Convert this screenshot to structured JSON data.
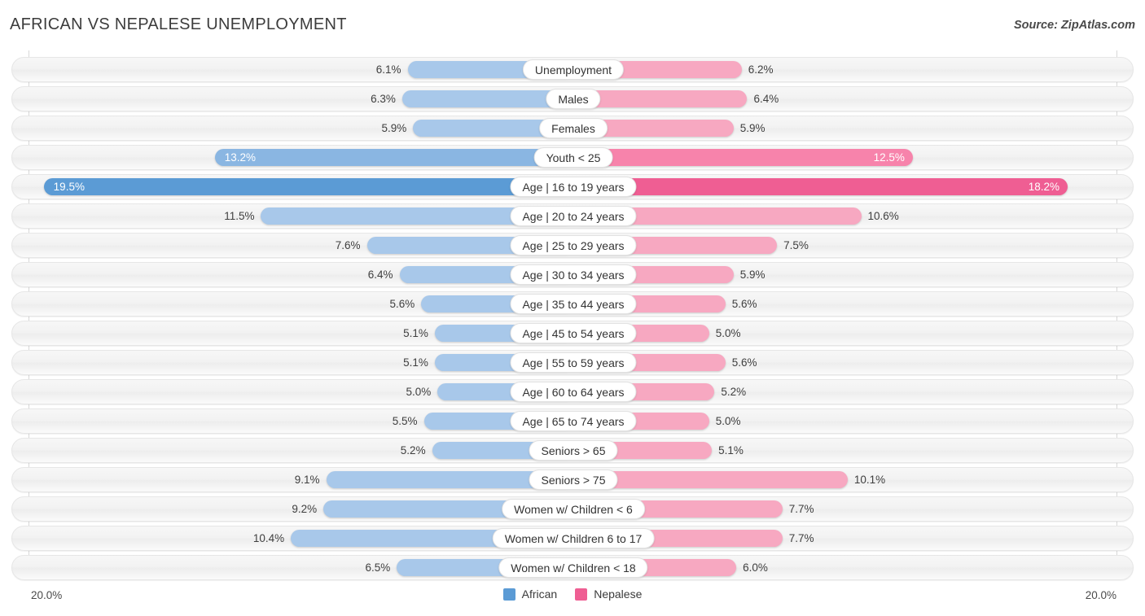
{
  "header": {
    "title": "AFRICAN VS NEPALESE UNEMPLOYMENT",
    "source": "Source: ZipAtlas.com"
  },
  "axis": {
    "left_label": "20.0%",
    "right_label": "20.0%",
    "max": 20.0
  },
  "legend": {
    "items": [
      {
        "label": "African",
        "color": "#5b9bd5",
        "icon": "square-swatch"
      },
      {
        "label": "Nepalese",
        "color": "#ef5e93",
        "icon": "square-swatch"
      }
    ]
  },
  "colors": {
    "african_light": "#a8c8ea",
    "african_mid": "#8ab6e2",
    "african_dark": "#5b9bd5",
    "nepalese_light": "#f7a8c1",
    "nepalese_mid": "#f783ab",
    "nepalese_dark": "#ef5e93",
    "track": "#f3f3f3",
    "axis": "#d8d8d8"
  },
  "chart_data": {
    "type": "bar",
    "orientation": "horizontal-diverging",
    "title": "AFRICAN VS NEPALESE UNEMPLOYMENT",
    "xlabel": "",
    "ylabel": "",
    "xlim": [
      20.0,
      20.0
    ],
    "grid": false,
    "legend_position": "bottom-center",
    "units": "percent",
    "categories": [
      "Unemployment",
      "Males",
      "Females",
      "Youth < 25",
      "Age | 16 to 19 years",
      "Age | 20 to 24 years",
      "Age | 25 to 29 years",
      "Age | 30 to 34 years",
      "Age | 35 to 44 years",
      "Age | 45 to 54 years",
      "Age | 55 to 59 years",
      "Age | 60 to 64 years",
      "Age | 65 to 74 years",
      "Seniors > 65",
      "Seniors > 75",
      "Women w/ Children < 6",
      "Women w/ Children 6 to 17",
      "Women w/ Children < 18"
    ],
    "series": [
      {
        "name": "African",
        "side": "left",
        "values": [
          6.1,
          6.3,
          5.9,
          13.2,
          19.5,
          11.5,
          7.6,
          6.4,
          5.6,
          5.1,
          5.1,
          5.0,
          5.5,
          5.2,
          9.1,
          9.2,
          10.4,
          6.5
        ],
        "labels": [
          "6.1%",
          "6.3%",
          "5.9%",
          "13.2%",
          "19.5%",
          "11.5%",
          "7.6%",
          "6.4%",
          "5.6%",
          "5.1%",
          "5.1%",
          "5.0%",
          "5.5%",
          "5.2%",
          "9.1%",
          "9.2%",
          "10.4%",
          "6.5%"
        ]
      },
      {
        "name": "Nepalese",
        "side": "right",
        "values": [
          6.2,
          6.4,
          5.9,
          12.5,
          18.2,
          10.6,
          7.5,
          5.9,
          5.6,
          5.0,
          5.6,
          5.2,
          5.0,
          5.1,
          10.1,
          7.7,
          7.7,
          6.0
        ],
        "labels": [
          "6.2%",
          "6.4%",
          "5.9%",
          "12.5%",
          "18.2%",
          "10.6%",
          "7.5%",
          "5.9%",
          "5.6%",
          "5.0%",
          "5.6%",
          "5.2%",
          "5.0%",
          "5.1%",
          "10.1%",
          "7.7%",
          "7.7%",
          "6.0%"
        ]
      }
    ]
  }
}
